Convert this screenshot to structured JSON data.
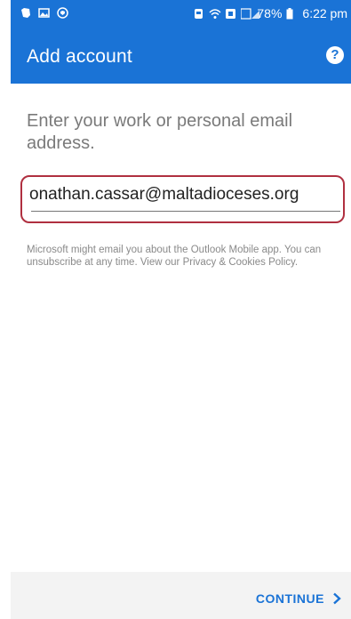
{
  "status_bar": {
    "battery": "78%",
    "time": "6:22 pm"
  },
  "app_bar": {
    "title": "Add account",
    "help_label": "?"
  },
  "prompt": {
    "text": "Enter your work or personal email address."
  },
  "email": {
    "value": "onathan.cassar@maltadioceses.org",
    "highlight_color": "#b03040"
  },
  "disclaimer": {
    "text": "Microsoft might email you about the Outlook Mobile app. You can unsubscribe at any time. View our Privacy & Cookies Policy."
  },
  "footer": {
    "continue_label": "CONTINUE"
  },
  "colors": {
    "brand": "#1a73d6",
    "bottom_bar": "#f3f3f3"
  },
  "icons": {
    "status_left": [
      "evernote-icon",
      "gallery-icon",
      "shield-icon"
    ],
    "status_right": [
      "alarm-icon",
      "wifi-icon",
      "nfc-icon",
      "signal-icon",
      "battery-icon"
    ]
  }
}
